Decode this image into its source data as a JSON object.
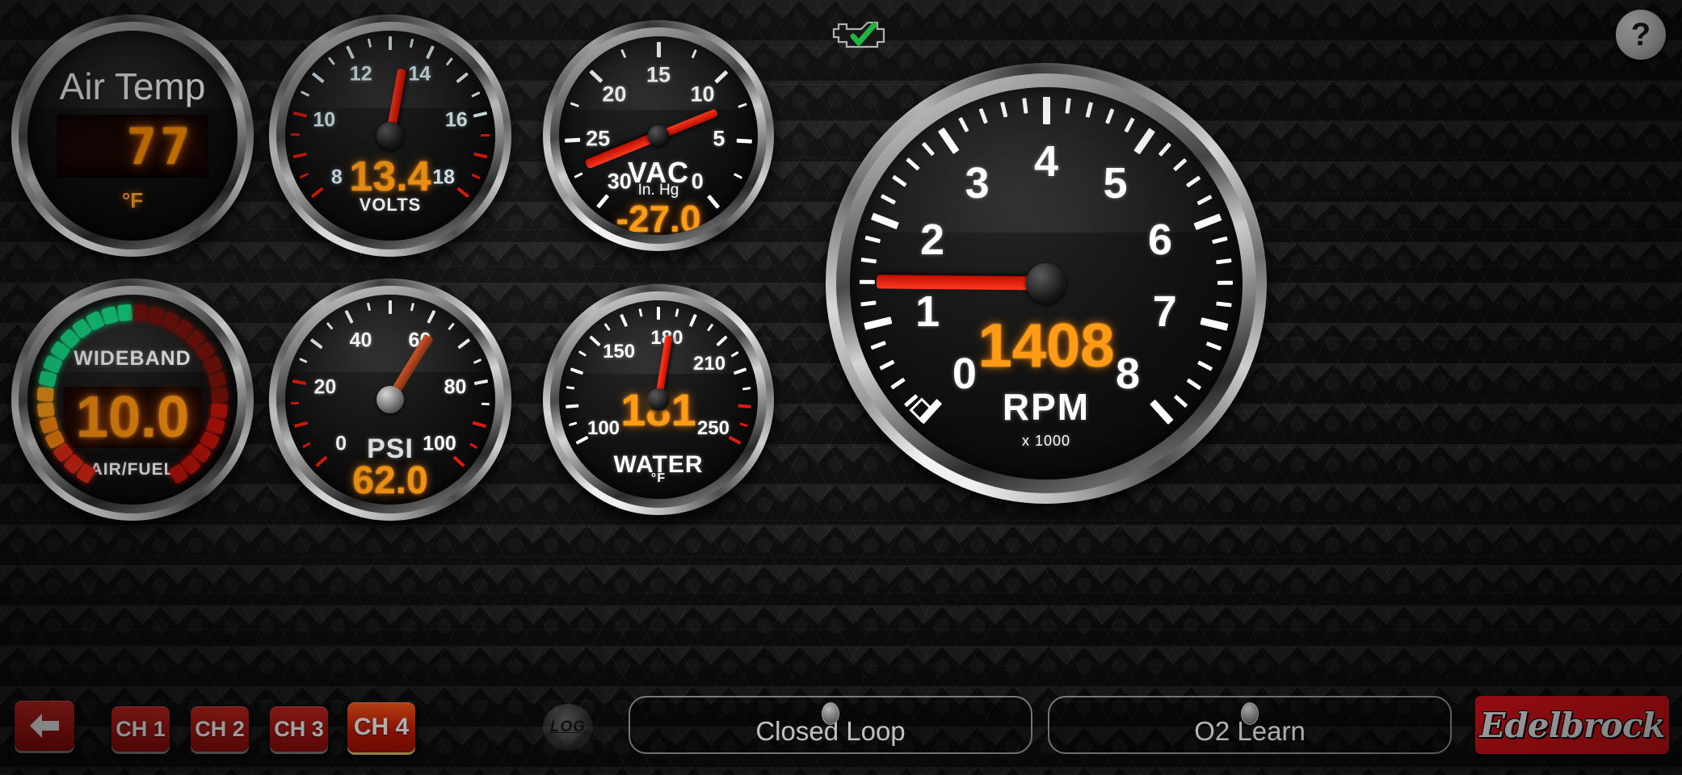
{
  "app": {
    "brand": "Edelbrock",
    "help_label": "?",
    "log_label": "LOG",
    "mil_icon": "check-engine-icon"
  },
  "gauges": {
    "air_temp": {
      "title": "Air Temp",
      "value": "77",
      "unit": "°F",
      "icon": "lcd-display-icon"
    },
    "volts": {
      "name": "VOLTS",
      "value": "13.4",
      "min": 8,
      "max": 18,
      "ticks": [
        "8",
        "10",
        "12",
        "14",
        "16",
        "18"
      ],
      "needle_value": 13.4,
      "redzone_low_end": 10,
      "redzone_high_start": 16.4
    },
    "vac": {
      "name": "VAC",
      "sub": "In. Hg",
      "value": "-27.0",
      "min": 0,
      "max": 30,
      "ticks": [
        "0",
        "5",
        "10",
        "15",
        "20",
        "25",
        "30"
      ],
      "needle_value": 27.0
    },
    "wideband": {
      "name": "WIDEBAND",
      "sub": "AIR/FUEL",
      "value": "10.0",
      "segment_colors": [
        "#e02a16",
        "#ff8a12",
        "#ffa01a",
        "#17e089",
        "#0fd47a"
      ]
    },
    "oil": {
      "name": "PSI",
      "value": "62.0",
      "min": 0,
      "max": 100,
      "ticks": [
        "0",
        "20",
        "40",
        "60",
        "80",
        "100"
      ],
      "needle_value": 62.0,
      "redzone_high_start": 22
    },
    "water": {
      "name": "WATER",
      "sub": "°F",
      "value": "181",
      "min": 100,
      "max": 250,
      "ticks": [
        "100",
        "150",
        "180",
        "210",
        "250"
      ],
      "needle_value": 181
    },
    "rpm": {
      "name": "RPM",
      "sub": "x 1000",
      "value": "1408",
      "min": 0,
      "max": 8,
      "ticks": [
        "0",
        "1",
        "2",
        "3",
        "4",
        "5",
        "6",
        "7",
        "8"
      ],
      "needle_value": 1.408
    }
  },
  "toolbar": {
    "back_label": "back-arrow-icon",
    "channels": [
      {
        "label": "CH 1",
        "active": false
      },
      {
        "label": "CH 2",
        "active": false
      },
      {
        "label": "CH 3",
        "active": false
      },
      {
        "label": "CH 4",
        "active": true
      }
    ],
    "status": [
      {
        "label": "Closed Loop",
        "led": "off"
      },
      {
        "label": "O2 Learn",
        "led": "off"
      }
    ]
  },
  "colors": {
    "accent_orange": "#ff9b15",
    "needle_red": "#ee2014",
    "brand_red": "#e8131a",
    "tick_blue": "#dff0f6",
    "segment_green": "#17e089"
  }
}
